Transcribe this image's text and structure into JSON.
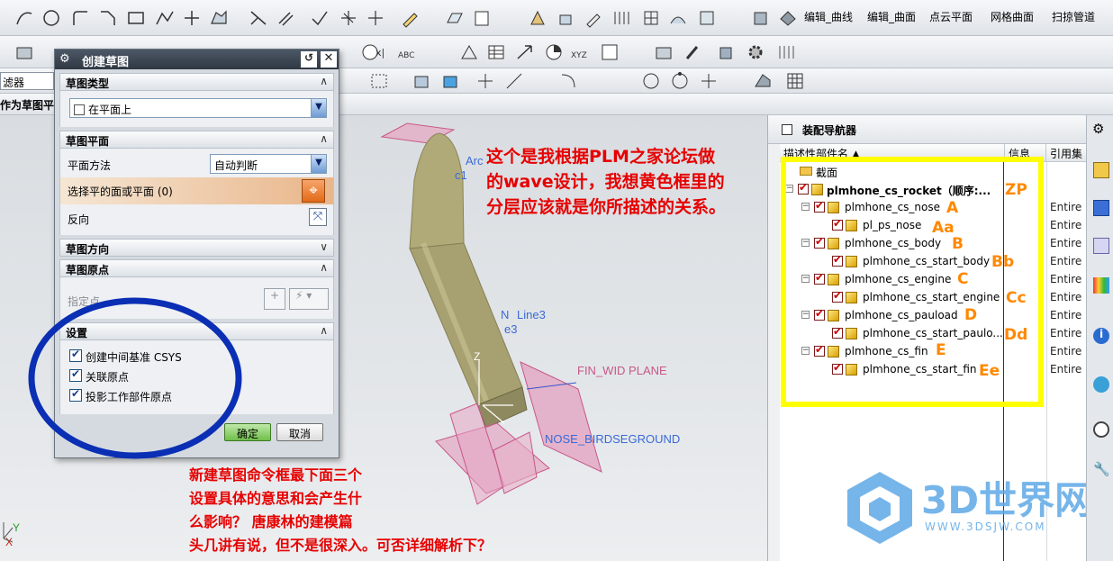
{
  "toolbar": {
    "menus": [
      "编辑_曲线",
      "编辑_曲面",
      "点云平面",
      "网格曲面",
      "扫掠管道"
    ],
    "filter_label": "滤器",
    "sketch_label": "作为草图平"
  },
  "dialog": {
    "title": "创建草图",
    "section_type": "草图类型",
    "type_value": "在平面上",
    "section_plane": "草图平面",
    "plane_method_label": "平面方法",
    "plane_method_value": "自动判断",
    "select_plane_label": "选择平的面或平面 (0)",
    "reverse_label": "反向",
    "section_direction": "草图方向",
    "section_origin": "草图原点",
    "specify_point": "指定点",
    "section_settings": "设置",
    "options": [
      "创建中间基准 CSYS",
      "关联原点",
      "投影工作部件原点"
    ],
    "ok_label": "确定",
    "cancel_label": "取消"
  },
  "navigator": {
    "title": "装配导航器",
    "col_name": "描述性部件名",
    "col_info": "信息",
    "col_ref": "引用集",
    "folder": "截面",
    "root": "plmhone_cs_rocket（顺序:...",
    "rows": [
      {
        "name": "plmhone_cs_nose",
        "ref": "Entire"
      },
      {
        "name": "pl_ps_nose",
        "ref": "Entire"
      },
      {
        "name": "plmhone_cs_body",
        "ref": "Entire"
      },
      {
        "name": "plmhone_cs_start_body",
        "ref": "Entire"
      },
      {
        "name": "plmhone_cs_engine",
        "ref": "Entire"
      },
      {
        "name": "plmhone_cs_start_engine",
        "ref": "Entire"
      },
      {
        "name": "plmhone_cs_pauload",
        "ref": "Entire"
      },
      {
        "name": "plmhone_cs_start_paulo...",
        "ref": "Entire"
      },
      {
        "name": "plmhone_cs_fin",
        "ref": "Entire"
      },
      {
        "name": "plmhone_cs_start_fin",
        "ref": "Entire"
      }
    ]
  },
  "annotations": {
    "letters": [
      "ZP",
      "A",
      "Aa",
      "B",
      "Bb",
      "C",
      "Cc",
      "D",
      "Dd",
      "E",
      "Ee"
    ],
    "note_top": [
      "这个是我根据PLM之家论坛做",
      "的wave设计，我想黄色框里的",
      "分层应该就是你所描述的关系。"
    ],
    "note_bottom": [
      "新建草图命令框最下面三个",
      "设置具体的意思和会产生什",
      "么影响？ 唐康林的建模篇",
      "头几讲有说，但不是很深入。可否详细解析下？"
    ]
  },
  "viewport": {
    "labels": [
      "Arc",
      "c1",
      "N",
      "Line3",
      "e3",
      "FIN_WID PLANE",
      "NOSE_BIRDSEGROUND",
      "Z",
      "Y",
      "X"
    ]
  },
  "watermark": {
    "logo_text": "3D世界网",
    "url": "WWW.3DSJW.COM"
  },
  "colors": {
    "note_red": "#e60000",
    "letter_orange": "#ff8800",
    "frame_yellow": "#ffff00",
    "circle_blue": "#0a2fb4",
    "rocket": "#a7a070",
    "plane_pink": "#d86a9a"
  }
}
